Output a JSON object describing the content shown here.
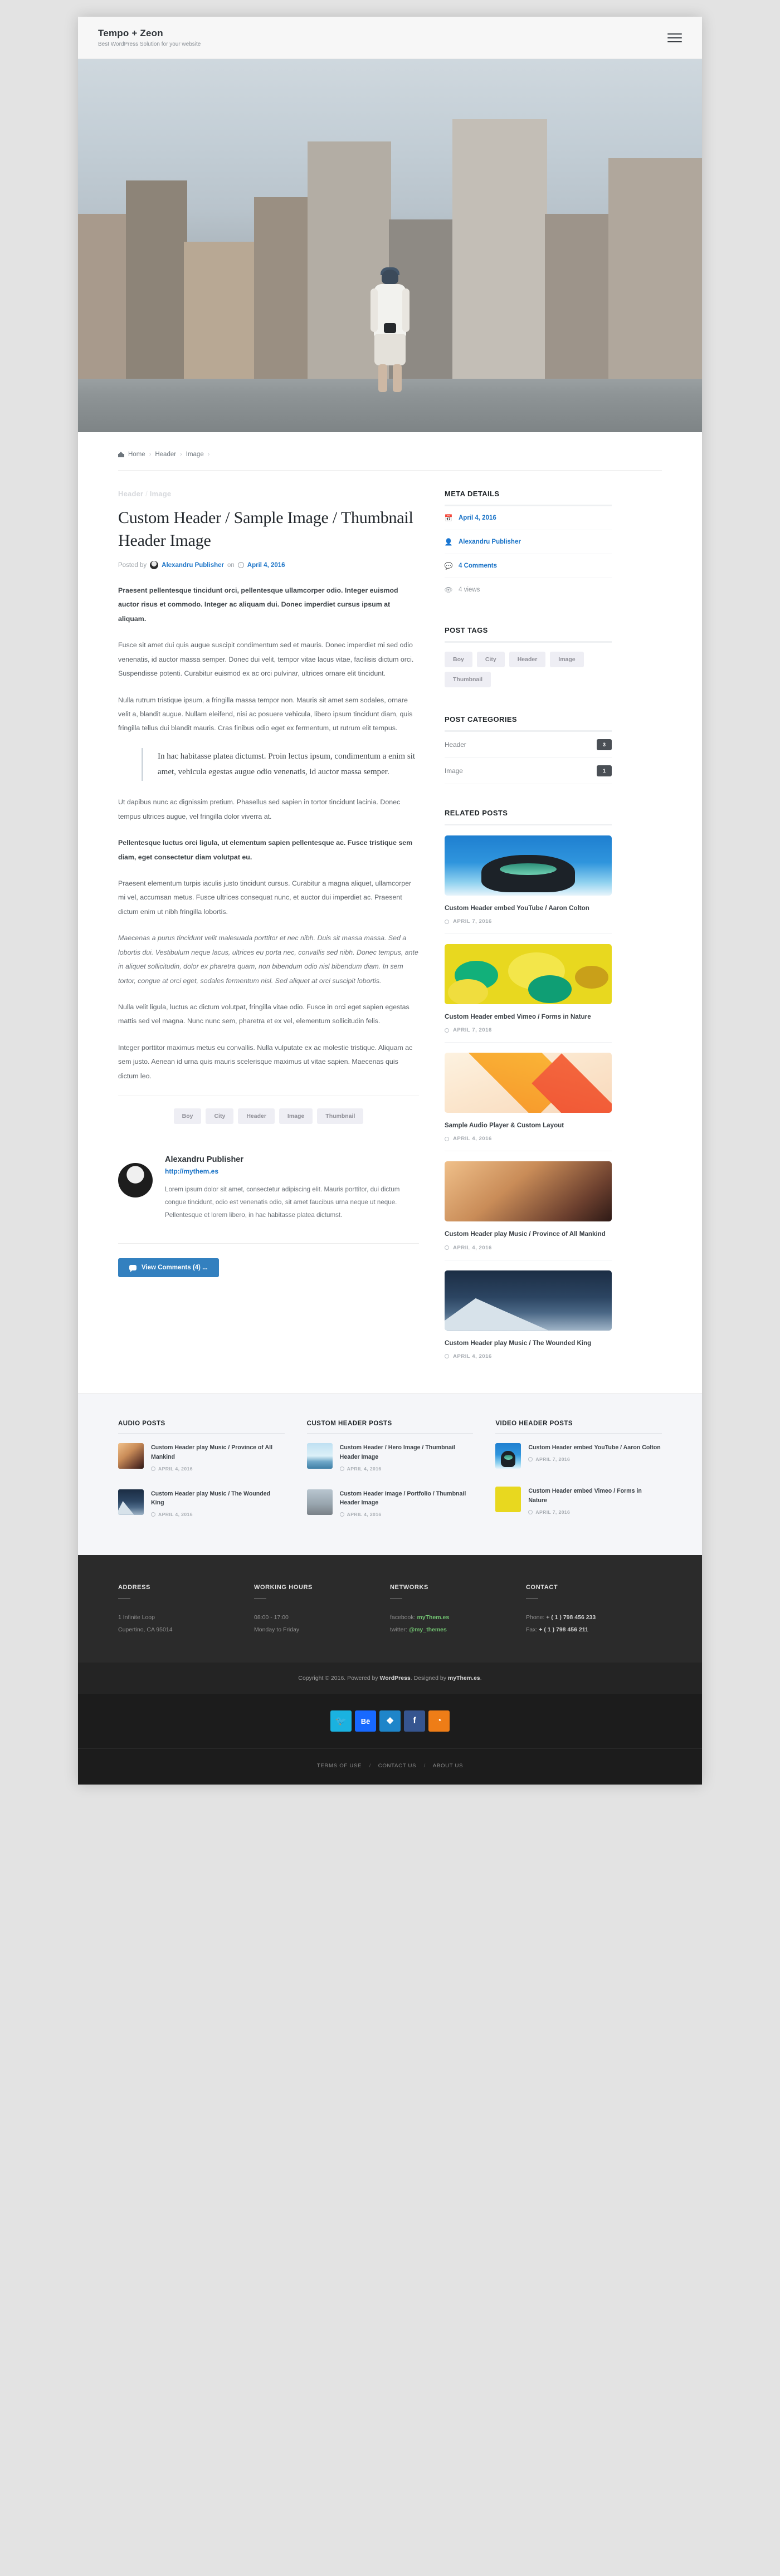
{
  "header": {
    "brand_title": "Tempo + Zeon",
    "brand_tagline": "Best WordPress Solution for your website",
    "menu_icon": "hamburger-icon"
  },
  "breadcrumb": {
    "home": "Home",
    "level2": "Header",
    "level3": "Image",
    "separator": "›"
  },
  "post": {
    "eyebrow_cat1": "Header",
    "eyebrow_sep": "/",
    "eyebrow_cat2": "Image",
    "title": "Custom Header / Sample Image / Thumbnail Header Image",
    "posted_by_label": "Posted by",
    "author": "Alexandru Publisher",
    "on_label": "on",
    "date": "April 4, 2016",
    "paragraphs": [
      {
        "style": "lead",
        "text": "Praesent pellentesque tincidunt orci, pellentesque ullamcorper odio. Integer euismod auctor risus et commodo. Integer ac aliquam dui. Donec imperdiet cursus ipsum at aliquam."
      },
      {
        "style": "normal",
        "text": "Fusce sit amet dui quis augue suscipit condimentum sed et mauris. Donec imperdiet mi sed odio venenatis, id auctor massa semper. Donec dui velit, tempor vitae lacus vitae, facilisis dictum orci. Suspendisse potenti. Curabitur euismod ex ac orci pulvinar, ultrices ornare elit tincidunt."
      },
      {
        "style": "normal",
        "text": "Nulla rutrum tristique ipsum, a fringilla massa tempor non. Mauris sit amet sem sodales, ornare velit a, blandit augue. Nullam eleifend, nisi ac posuere vehicula, libero ipsum tincidunt diam, quis fringilla tellus dui blandit mauris. Cras finibus odio eget ex fermentum, ut rutrum elit tempus."
      }
    ],
    "blockquote": "In hac habitasse platea dictumst. Proin lectus ipsum, condimentum a enim sit amet, vehicula egestas augue odio venenatis, id auctor massa semper.",
    "paragraphs_after": [
      {
        "style": "normal",
        "text": "Ut dapibus nunc ac dignissim pretium. Phasellus sed sapien in tortor tincidunt lacinia. Donec tempus ultrices augue, vel fringilla dolor viverra at."
      },
      {
        "style": "bold",
        "text": "Pellentesque luctus orci ligula, ut elementum sapien pellentesque ac. Fusce tristique sem diam, eget consectetur diam volutpat eu."
      },
      {
        "style": "normal",
        "text": "Praesent elementum turpis iaculis justo tincidunt cursus. Curabitur a magna aliquet, ullamcorper mi vel, accumsan metus. Fusce ultrices consequat nunc, et auctor dui imperdiet ac. Praesent dictum enim ut nibh fringilla lobortis."
      },
      {
        "style": "ital",
        "text": "Maecenas a purus tincidunt velit malesuada porttitor et nec nibh. Duis sit massa massa. Sed a lobortis dui. Vestibulum neque lacus, ultrices eu porta nec, convallis sed nibh. Donec tempus, ante in aliquet sollicitudin, dolor ex pharetra quam, non bibendum odio nisl bibendum diam. In sem tortor, congue at orci eget, sodales fermentum nisl. Sed aliquet at orci suscipit lobortis."
      },
      {
        "style": "normal",
        "text": "Nulla velit ligula, luctus ac dictum volutpat, fringilla vitae odio. Fusce in orci eget sapien egestas mattis sed vel magna. Nunc nunc sem, pharetra et ex vel, elementum sollicitudin felis."
      },
      {
        "style": "normal",
        "text": "Integer porttitor maximus metus eu convallis. Nulla vulputate ex ac molestie tristique. Aliquam ac sem justo. Aenean id urna quis mauris scelerisque maximus ut vitae sapien. Maecenas quis dictum leo."
      }
    ],
    "tags": [
      "Boy",
      "City",
      "Header",
      "Image",
      "Thumbnail"
    ]
  },
  "author_box": {
    "name": "Alexandru Publisher",
    "url": "http://mythem.es",
    "bio": "Lorem ipsum dolor sit amet, consectetur adipiscing elit. Mauris porttitor, dui dictum congue tincidunt, odio est venenatis odio, sit amet faucibus urna neque ut neque. Pellentesque et lorem libero, in hac habitasse platea dictumst.",
    "avatar": "author-avatar"
  },
  "comments_button": {
    "label": "View Comments (4) ...",
    "icon": "comment-bubble-icon"
  },
  "sidebar": {
    "meta_details": {
      "title": "META DETAILS",
      "items": [
        {
          "icon": "calendar-icon",
          "label": "April 4, 2016",
          "link": true
        },
        {
          "icon": "user-icon",
          "label": "Alexandru Publisher",
          "link": true
        },
        {
          "icon": "comment-icon",
          "label": "4 Comments",
          "link": true
        },
        {
          "icon": "eye-icon",
          "label": "4 views",
          "link": false
        }
      ]
    },
    "post_tags": {
      "title": "POST TAGS",
      "tags": [
        "Boy",
        "City",
        "Header",
        "Image",
        "Thumbnail"
      ]
    },
    "post_categories": {
      "title": "POST CATEGORIES",
      "items": [
        {
          "name": "Header",
          "count": "3"
        },
        {
          "name": "Image",
          "count": "1"
        }
      ]
    },
    "related_posts": {
      "title": "RELATED POSTS",
      "items": [
        {
          "title": "Custom Header embed YouTube / Aaron Colton",
          "date": "APRIL 7, 2016",
          "art": "t-sky"
        },
        {
          "title": "Custom Header embed Vimeo / Forms in Nature",
          "date": "APRIL 7, 2016",
          "art": "t-forms"
        },
        {
          "title": "Sample Audio Player & Custom Layout",
          "date": "APRIL 4, 2016",
          "art": "t-waste"
        },
        {
          "title": "Custom Header play Music / Province of All Mankind",
          "date": "APRIL 4, 2016",
          "art": "t-stairs"
        },
        {
          "title": "Custom Header play Music / The Wounded King",
          "date": "APRIL 4, 2016",
          "art": "t-mount"
        }
      ]
    }
  },
  "bottom_widgets": [
    {
      "title": "AUDIO POSTS",
      "items": [
        {
          "title": "Custom Header play Music / Province of All Mankind",
          "date": "APRIL 4, 2016",
          "art": "t-stairs"
        },
        {
          "title": "Custom Header play Music / The Wounded King",
          "date": "APRIL 4, 2016",
          "art": "t-mount"
        }
      ]
    },
    {
      "title": "CUSTOM HEADER POSTS",
      "items": [
        {
          "title": "Custom Header / Hero Image / Thumbnail Header Image",
          "date": "APRIL 4, 2016",
          "art": "t-pier"
        },
        {
          "title": "Custom Header Image / Portfolio / Thumbnail Header Image",
          "date": "APRIL 4, 2016",
          "art": "t-hero"
        }
      ]
    },
    {
      "title": "VIDEO HEADER POSTS",
      "items": [
        {
          "title": "Custom Header embed YouTube / Aaron Colton",
          "date": "APRIL 7, 2016",
          "art": "t-sky"
        },
        {
          "title": "Custom Header embed Vimeo / Forms in Nature",
          "date": "APRIL 7, 2016",
          "art": "t-forms"
        }
      ]
    }
  ],
  "footer": {
    "columns": [
      {
        "title": "ADDRESS",
        "line1": "1 Infinite Loop",
        "line2": "Cupertino, CA 95014"
      },
      {
        "title": "WORKING HOURS",
        "line1": "08:00 - 17:00",
        "line2": "Monday to Friday"
      },
      {
        "title": "NETWORKS",
        "line1_prefix": "facebook: ",
        "line1_value": "myThem.es",
        "line2_prefix": "twitter: ",
        "line2_value": "@my_themes"
      },
      {
        "title": "CONTACT",
        "line1_prefix": "Phone: ",
        "line1_value": "+ ( 1 ) 798 456 233",
        "line2_prefix": "Fax: ",
        "line2_value": "+ ( 1 ) 798 456 211"
      }
    ],
    "credit_prefix": "Copyright © 2016. Powered by ",
    "credit_wp": "WordPress",
    "credit_mid": ". Designed by ",
    "credit_designer": "myThem.es",
    "credit_suffix": ".",
    "social": [
      {
        "name": "twitter-icon",
        "glyph": "🐦",
        "color": "#1ab2e0"
      },
      {
        "name": "behance-icon",
        "glyph": "Bē",
        "color": "#1769ff"
      },
      {
        "name": "dropbox-icon",
        "glyph": "❖",
        "color": "#1e85c9"
      },
      {
        "name": "facebook-icon",
        "glyph": "f",
        "color": "#36558f"
      },
      {
        "name": "rss-icon",
        "glyph": "◔",
        "color": "#ee7d17"
      }
    ],
    "nav": [
      "TERMS OF USE",
      "CONTACT US",
      "ABOUT US"
    ],
    "nav_sep": "/"
  }
}
